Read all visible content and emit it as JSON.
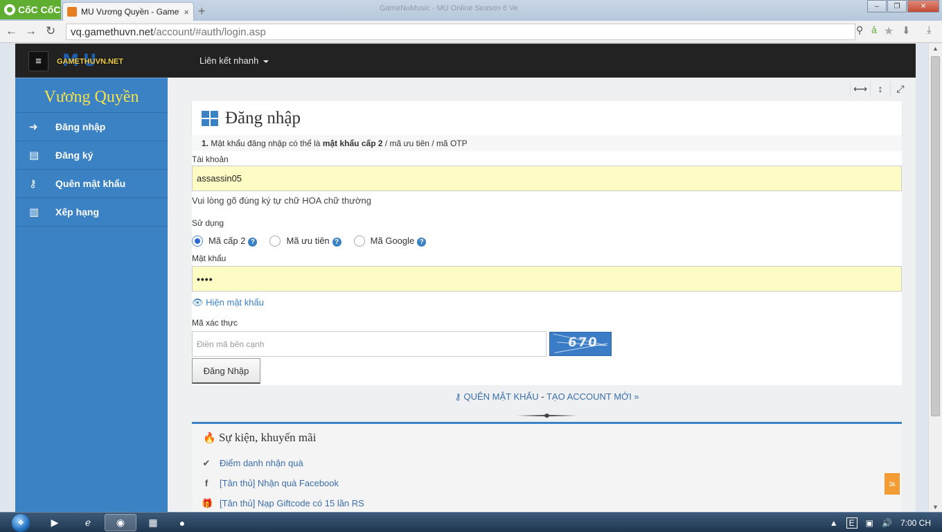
{
  "browser": {
    "brand": "CốC CốC",
    "tab_title": "MU Vương Quyền - Gamet",
    "tab_close": "×",
    "new_tab": "+",
    "bg_tab_title": "GameNuMusic - MU Online Season 6 Ve",
    "url_host": "vq.gamethuvn.net",
    "url_path": "/account/#auth/login.asp"
  },
  "topnav": {
    "logo_mu": "MU",
    "logo_site": "GAMETHUVN.NET",
    "quick_links": "Liên kết nhanh"
  },
  "sidebar": {
    "title": "Vương Quyền",
    "items": [
      {
        "label": "Đăng nhập",
        "icon": "sign-in-icon"
      },
      {
        "label": "Đăng ký",
        "icon": "document-icon"
      },
      {
        "label": "Quên mật khẩu",
        "icon": "key-icon"
      },
      {
        "label": "Xếp hạng",
        "icon": "bar-chart-icon"
      }
    ]
  },
  "login": {
    "title": "Đăng nhập",
    "note_num": "1.",
    "note_pre": "Mật khẩu đăng nhập có thể là",
    "note_bold": "mật khẩu cấp 2",
    "note_post": "/ mã ưu tiên / mã OTP",
    "account_label": "Tài khoản",
    "account_value": "assassin05",
    "account_hint": "Vui lòng gõ đúng ký tự chữ HOA chữ thường",
    "use_label": "Sử dụng",
    "options": [
      {
        "label": "Mã cấp 2",
        "checked": true
      },
      {
        "label": "Mã ưu tiên",
        "checked": false
      },
      {
        "label": "Mã Google",
        "checked": false
      }
    ],
    "password_label": "Mật khẩu",
    "password_value": "••••",
    "show_password": "Hiện mật khẩu",
    "captcha_label": "Mã xác thực",
    "captcha_placeholder": "Điền mã bên cạnh",
    "captcha_code": "670",
    "submit": "Đăng Nhập",
    "forgot_link": "QUÊN MẬT KHẨU",
    "link_sep": "-",
    "create_link": "TẠO ACCOUNT MỚI »"
  },
  "events": {
    "title": "Sự kiện, khuyến mãi",
    "items": [
      {
        "label": "Điểm danh nhận quà",
        "icon": "check-circle-icon"
      },
      {
        "label": "[Tân thủ] Nhận quà Facebook",
        "icon": "facebook-icon"
      },
      {
        "label": "[Tân thủ] Nạp Giftcode có 15 lần RS",
        "icon": "gift-icon"
      }
    ]
  },
  "badge": "3k",
  "taskbar": {
    "clock": "7:00 CH",
    "lang": "E"
  },
  "colors": {
    "sidebar": "#3b82c4",
    "topnav": "#222222",
    "input_fill": "#fdfcc4",
    "sidebar_title": "#f7e24b"
  }
}
